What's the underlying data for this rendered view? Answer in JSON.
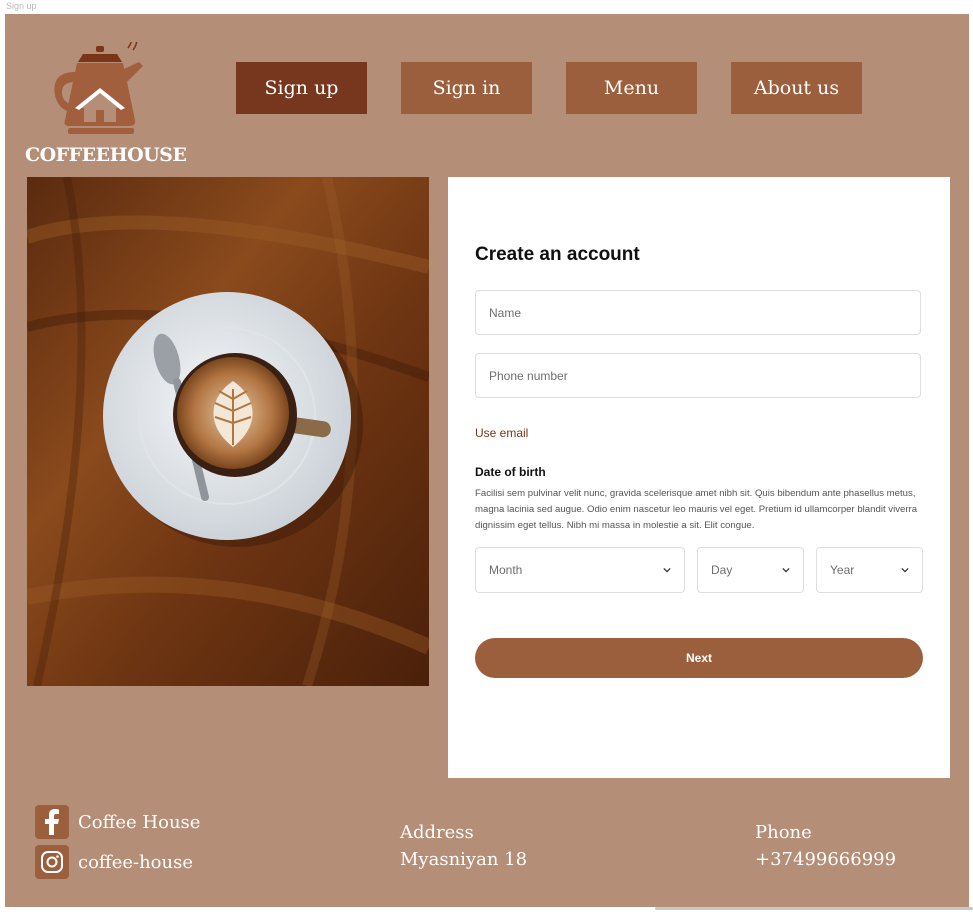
{
  "frame_label": "Sign up",
  "brand": {
    "logo_text": "COFFEEHOUSE"
  },
  "nav": {
    "items": [
      {
        "label": "Sign up",
        "active": true
      },
      {
        "label": "Sign in",
        "active": false
      },
      {
        "label": "Menu",
        "active": false
      },
      {
        "label": "About us",
        "active": false
      }
    ]
  },
  "form": {
    "title": "Create an account",
    "name_placeholder": "Name",
    "phone_placeholder": "Phone number",
    "use_email": "Use email",
    "dob_label": "Date of birth",
    "dob_description": "Facilisi sem pulvinar velit nunc, gravida scelerisque amet nibh sit. Quis bibendum ante phasellus metus, magna lacinia sed augue. Odio enim nascetur leo mauris vel eget. Pretium id ullamcorper blandit viverra dignissim eget tellus. Nibh mi massa in molestie a sit. Elit congue.",
    "month": "Month",
    "day": "Day",
    "year": "Year",
    "next_label": "Next"
  },
  "footer": {
    "facebook": "Coffee House",
    "instagram": "coffee-house",
    "address_label": "Address",
    "address_value": "Myasniyan 18",
    "phone_label": "Phone",
    "phone_value": "+37499666999"
  },
  "colors": {
    "background": "#b58e77",
    "button": "#9c5f3d",
    "button_active": "#76371e",
    "link": "#7a3519"
  }
}
